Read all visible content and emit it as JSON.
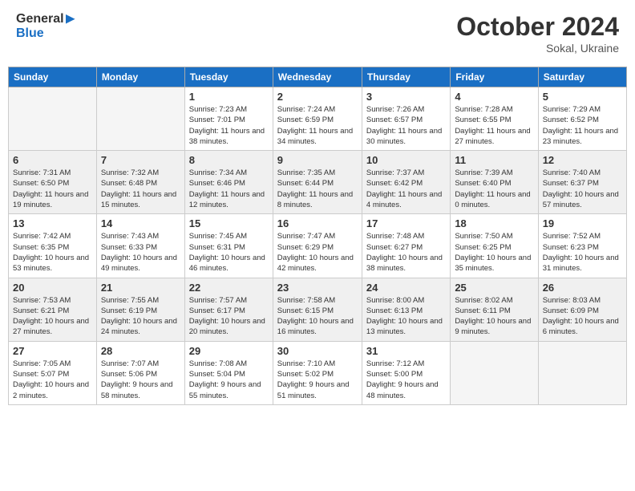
{
  "header": {
    "logo_general": "General",
    "logo_blue": "Blue",
    "month_title": "October 2024",
    "location": "Sokal, Ukraine"
  },
  "weekdays": [
    "Sunday",
    "Monday",
    "Tuesday",
    "Wednesday",
    "Thursday",
    "Friday",
    "Saturday"
  ],
  "weeks": [
    [
      {
        "day": "",
        "info": ""
      },
      {
        "day": "",
        "info": ""
      },
      {
        "day": "1",
        "info": "Sunrise: 7:23 AM\nSunset: 7:01 PM\nDaylight: 11 hours and 38 minutes."
      },
      {
        "day": "2",
        "info": "Sunrise: 7:24 AM\nSunset: 6:59 PM\nDaylight: 11 hours and 34 minutes."
      },
      {
        "day": "3",
        "info": "Sunrise: 7:26 AM\nSunset: 6:57 PM\nDaylight: 11 hours and 30 minutes."
      },
      {
        "day": "4",
        "info": "Sunrise: 7:28 AM\nSunset: 6:55 PM\nDaylight: 11 hours and 27 minutes."
      },
      {
        "day": "5",
        "info": "Sunrise: 7:29 AM\nSunset: 6:52 PM\nDaylight: 11 hours and 23 minutes."
      }
    ],
    [
      {
        "day": "6",
        "info": "Sunrise: 7:31 AM\nSunset: 6:50 PM\nDaylight: 11 hours and 19 minutes."
      },
      {
        "day": "7",
        "info": "Sunrise: 7:32 AM\nSunset: 6:48 PM\nDaylight: 11 hours and 15 minutes."
      },
      {
        "day": "8",
        "info": "Sunrise: 7:34 AM\nSunset: 6:46 PM\nDaylight: 11 hours and 12 minutes."
      },
      {
        "day": "9",
        "info": "Sunrise: 7:35 AM\nSunset: 6:44 PM\nDaylight: 11 hours and 8 minutes."
      },
      {
        "day": "10",
        "info": "Sunrise: 7:37 AM\nSunset: 6:42 PM\nDaylight: 11 hours and 4 minutes."
      },
      {
        "day": "11",
        "info": "Sunrise: 7:39 AM\nSunset: 6:40 PM\nDaylight: 11 hours and 0 minutes."
      },
      {
        "day": "12",
        "info": "Sunrise: 7:40 AM\nSunset: 6:37 PM\nDaylight: 10 hours and 57 minutes."
      }
    ],
    [
      {
        "day": "13",
        "info": "Sunrise: 7:42 AM\nSunset: 6:35 PM\nDaylight: 10 hours and 53 minutes."
      },
      {
        "day": "14",
        "info": "Sunrise: 7:43 AM\nSunset: 6:33 PM\nDaylight: 10 hours and 49 minutes."
      },
      {
        "day": "15",
        "info": "Sunrise: 7:45 AM\nSunset: 6:31 PM\nDaylight: 10 hours and 46 minutes."
      },
      {
        "day": "16",
        "info": "Sunrise: 7:47 AM\nSunset: 6:29 PM\nDaylight: 10 hours and 42 minutes."
      },
      {
        "day": "17",
        "info": "Sunrise: 7:48 AM\nSunset: 6:27 PM\nDaylight: 10 hours and 38 minutes."
      },
      {
        "day": "18",
        "info": "Sunrise: 7:50 AM\nSunset: 6:25 PM\nDaylight: 10 hours and 35 minutes."
      },
      {
        "day": "19",
        "info": "Sunrise: 7:52 AM\nSunset: 6:23 PM\nDaylight: 10 hours and 31 minutes."
      }
    ],
    [
      {
        "day": "20",
        "info": "Sunrise: 7:53 AM\nSunset: 6:21 PM\nDaylight: 10 hours and 27 minutes."
      },
      {
        "day": "21",
        "info": "Sunrise: 7:55 AM\nSunset: 6:19 PM\nDaylight: 10 hours and 24 minutes."
      },
      {
        "day": "22",
        "info": "Sunrise: 7:57 AM\nSunset: 6:17 PM\nDaylight: 10 hours and 20 minutes."
      },
      {
        "day": "23",
        "info": "Sunrise: 7:58 AM\nSunset: 6:15 PM\nDaylight: 10 hours and 16 minutes."
      },
      {
        "day": "24",
        "info": "Sunrise: 8:00 AM\nSunset: 6:13 PM\nDaylight: 10 hours and 13 minutes."
      },
      {
        "day": "25",
        "info": "Sunrise: 8:02 AM\nSunset: 6:11 PM\nDaylight: 10 hours and 9 minutes."
      },
      {
        "day": "26",
        "info": "Sunrise: 8:03 AM\nSunset: 6:09 PM\nDaylight: 10 hours and 6 minutes."
      }
    ],
    [
      {
        "day": "27",
        "info": "Sunrise: 7:05 AM\nSunset: 5:07 PM\nDaylight: 10 hours and 2 minutes."
      },
      {
        "day": "28",
        "info": "Sunrise: 7:07 AM\nSunset: 5:06 PM\nDaylight: 9 hours and 58 minutes."
      },
      {
        "day": "29",
        "info": "Sunrise: 7:08 AM\nSunset: 5:04 PM\nDaylight: 9 hours and 55 minutes."
      },
      {
        "day": "30",
        "info": "Sunrise: 7:10 AM\nSunset: 5:02 PM\nDaylight: 9 hours and 51 minutes."
      },
      {
        "day": "31",
        "info": "Sunrise: 7:12 AM\nSunset: 5:00 PM\nDaylight: 9 hours and 48 minutes."
      },
      {
        "day": "",
        "info": ""
      },
      {
        "day": "",
        "info": ""
      }
    ]
  ]
}
